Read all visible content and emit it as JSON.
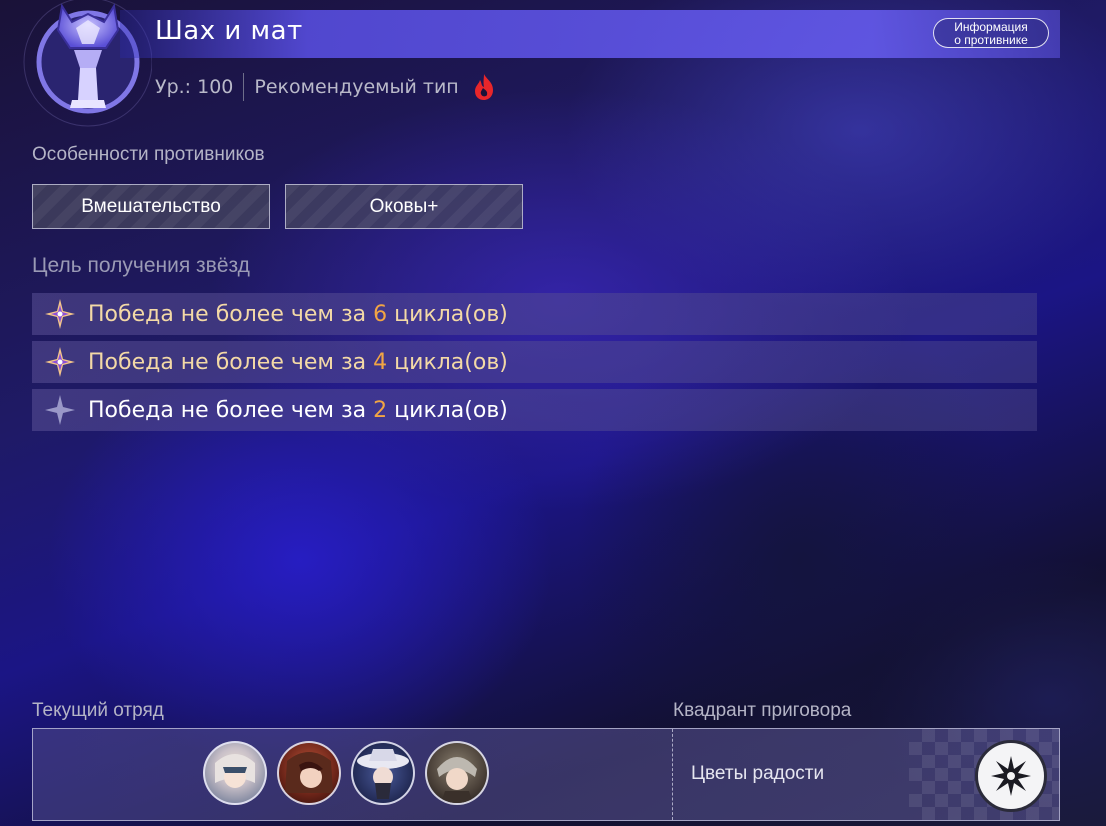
{
  "header": {
    "title": "Шах и мат",
    "level": "Ур.: 100",
    "recommended_type": "Рекомендуемый тип",
    "recommended_type_icon": "fire-element-icon",
    "enemy_info_button": {
      "line1": "Информация",
      "line2": "о противнике"
    }
  },
  "traits": {
    "label": "Особенности противников",
    "items": [
      "Вмешательство",
      "Оковы+"
    ]
  },
  "star_goals": {
    "label": "Цель получения звёзд",
    "items": [
      {
        "prefix": "Победа не более чем за",
        "number": "6",
        "suffix": "цикла(ов)",
        "achieved": true
      },
      {
        "prefix": "Победа не более чем за",
        "number": "4",
        "suffix": "цикла(ов)",
        "achieved": true
      },
      {
        "prefix": "Победа не более чем за",
        "number": "2",
        "suffix": "цикла(ов)",
        "achieved": false
      }
    ]
  },
  "squad": {
    "label": "Текущий отряд",
    "members": [
      "character-1",
      "character-2",
      "character-3",
      "character-4"
    ]
  },
  "quadrant": {
    "label": "Квадрант приговора",
    "name": "Цветы радости",
    "icon": "path-elation-icon"
  },
  "colors": {
    "accent_number": "#f2a544",
    "achieved_text": "#f3d9a6",
    "title_bar": "#6a5ae6",
    "fire_icon": "#e8262a"
  }
}
